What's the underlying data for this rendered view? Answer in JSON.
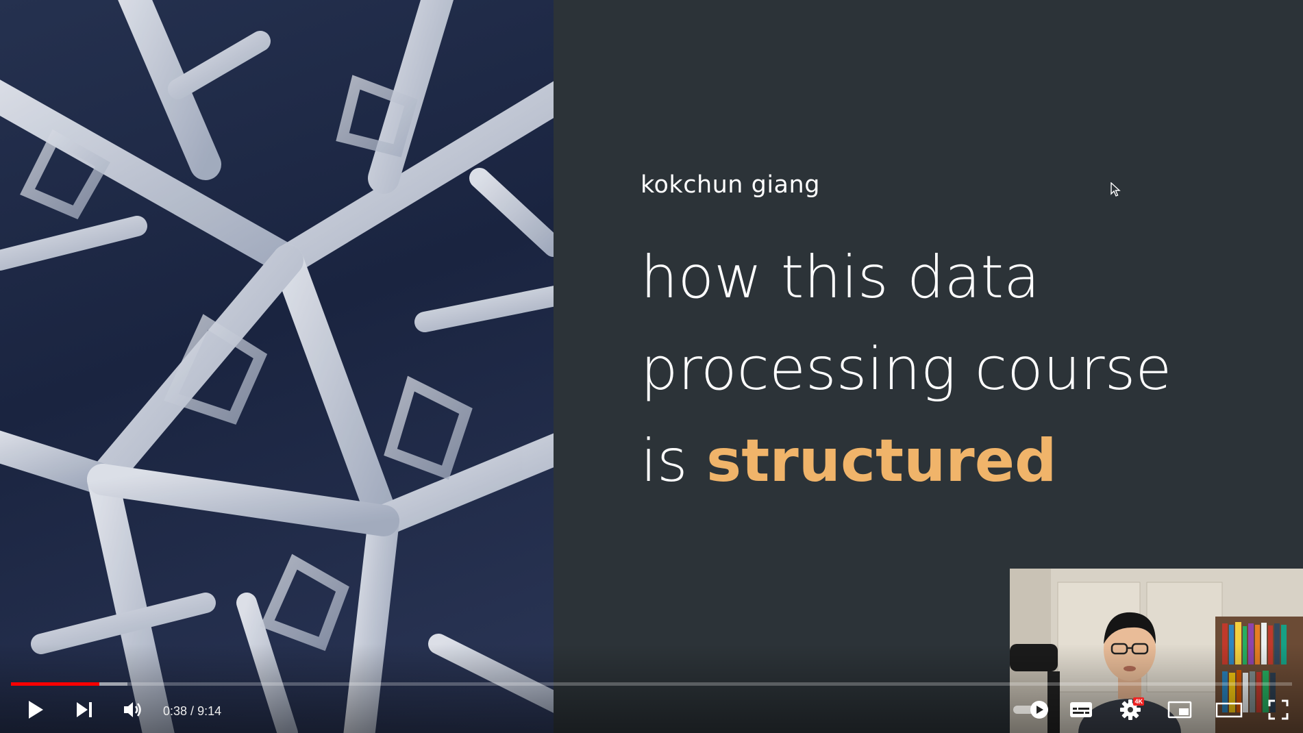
{
  "slide": {
    "author": "kokchun giang",
    "title_line_1": "how this data",
    "title_line_2": "processing course",
    "title_line_3_prefix": "is ",
    "title_line_3_accent": "structured",
    "accent_color": "#f0b46a",
    "background_color": "#2c3338"
  },
  "player": {
    "time_current": "0:38",
    "time_separator": " / ",
    "time_total": "9:14",
    "progress_played_fraction": 0.069,
    "progress_buffered_fraction": 0.091,
    "progress_color": "#ff0000",
    "quality_badge": "4K",
    "controls": {
      "play": "play-icon",
      "next": "next-icon",
      "volume": "volume-icon",
      "autoplay": "autoplay-toggle-icon",
      "subtitles": "subtitles-icon",
      "settings": "gear-icon",
      "miniplayer": "miniplayer-icon",
      "theater": "theater-mode-icon",
      "fullscreen": "fullscreen-icon"
    }
  }
}
